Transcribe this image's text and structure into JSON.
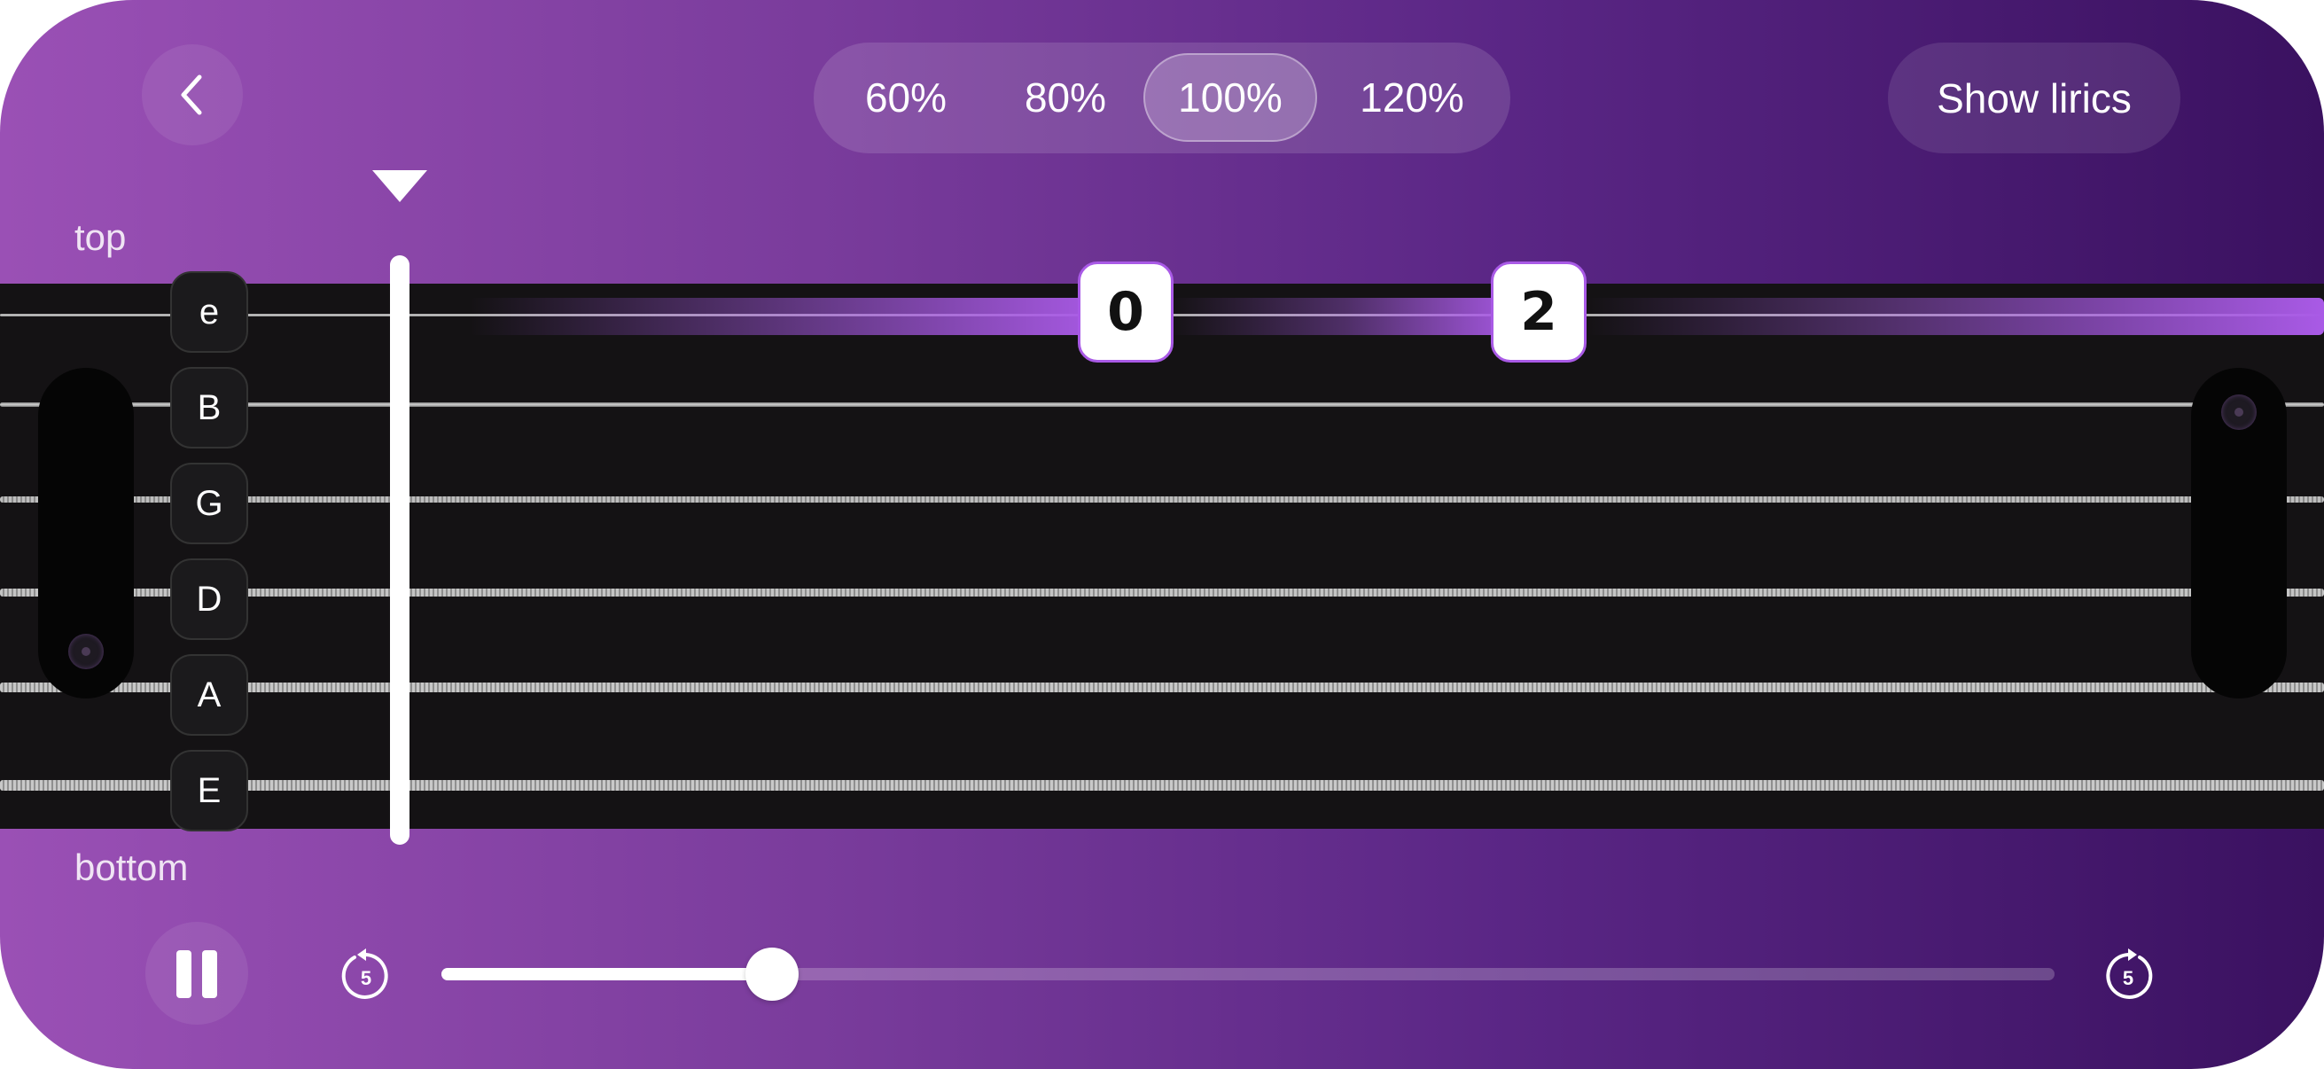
{
  "header": {
    "speed_options": [
      "60%",
      "80%",
      "100%",
      "120%"
    ],
    "speed_selected": "100%",
    "lyrics_button_label": "Show lirics"
  },
  "fretboard": {
    "top_label": "top",
    "bottom_label": "bottom",
    "strings": [
      "e",
      "B",
      "G",
      "D",
      "A",
      "E"
    ],
    "notes": [
      {
        "string": "e",
        "fret": "0"
      },
      {
        "string": "e",
        "fret": "2"
      }
    ]
  },
  "player": {
    "state": "playing",
    "skip_back_seconds": "5",
    "skip_forward_seconds": "5",
    "progress_fraction": 0.205
  },
  "colors": {
    "accent": "#a95ae6",
    "gradient_start": "#9a50b5",
    "gradient_end": "#3a1160",
    "fretboard": "#141214"
  },
  "icons": {
    "back": "chevron-left-icon",
    "pause": "pause-icon",
    "skip_back": "rewind-5-icon",
    "skip_forward": "forward-5-icon",
    "playhead": "triangle-down-icon"
  }
}
